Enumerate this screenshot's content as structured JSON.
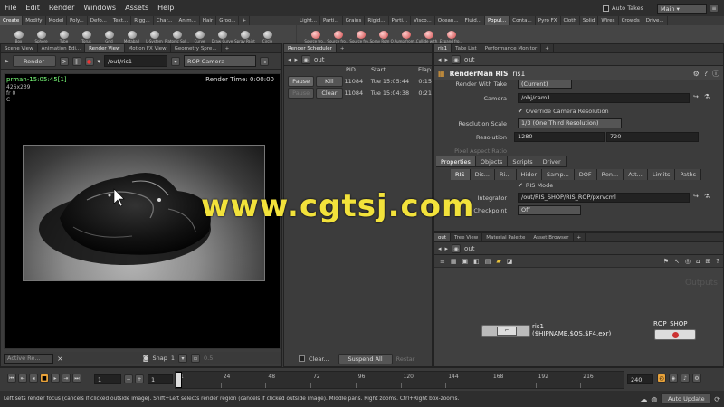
{
  "menu": [
    "File",
    "Edit",
    "Render",
    "Windows",
    "Assets",
    "Help"
  ],
  "auto_takes_label": "Auto Takes",
  "desktop": "Main",
  "shelf_tabs_left": [
    "Create",
    "Modify",
    "Model",
    "Poly...",
    "Defo...",
    "Text...",
    "Rigg...",
    "Char...",
    "Anim...",
    "Hair",
    "Groo..."
  ],
  "shelf_tabs_right": [
    "Light...",
    "Parti...",
    "Grains",
    "Rigid...",
    "Parti...",
    "Visco...",
    "Ocean...",
    "Fluid...",
    "Popul...",
    "Conta...",
    "Pyro FX",
    "Cloth",
    "Solid",
    "Wires",
    "Crowds",
    "Drive..."
  ],
  "tools_left": [
    "Box",
    "Sphere",
    "Tube",
    "Torus",
    "Grid",
    "Metaball",
    "L-System",
    "Platonic Sol...",
    "Curve",
    "Draw Curve",
    "Spray Paint",
    "Circle"
  ],
  "tools_right": [
    "Source fro...",
    "Source fro...",
    "Source fro...",
    "Spray Rom O...",
    "Pump from...",
    "Collide with...",
    "Expand fro..."
  ],
  "render_view": {
    "tabs": [
      "Scene View",
      "Animation Edi...",
      "Render View",
      "Motion FX View",
      "Geometry Spre..."
    ],
    "render_label": "Render",
    "path": "/out/ris1",
    "camera": "ROP Camera",
    "image_name": "prman-15:05:45[1]",
    "info": [
      "426x239",
      "fr 0",
      "C"
    ],
    "render_time": "Render Time: 0:00:00",
    "active_label": "Active Re...",
    "snap_label": "Snap",
    "snap_value": "1",
    "scale_value": "0.5"
  },
  "scheduler": {
    "tabs": [
      "Render Scheduler"
    ],
    "path": "out",
    "columns": [
      "PID",
      "Start",
      "Elap"
    ],
    "rows": [
      {
        "pid": "11084",
        "start": "Tue 15:05:44",
        "elap": "0:15"
      },
      {
        "pid": "11084",
        "start": "Tue 15:04:38",
        "elap": "0:21"
      }
    ],
    "pause_label": "Pause",
    "kill_label": "Kill",
    "clear_label": "Clear",
    "clear_check_label": "Clear...",
    "suspend_label": "Suspend All",
    "restart_label": "Restar"
  },
  "params": {
    "tabs": [
      "ris1",
      "Take List",
      "Performance Monitor"
    ],
    "path": "out",
    "node_type": "RenderMan RIS",
    "node_name": "ris1",
    "render_with_take_label": "Render With Take",
    "render_with_take_value": "(Current)",
    "camera_label": "Camera",
    "camera_value": "/obj/cam1",
    "override_label": "Override Camera Resolution",
    "res_scale_label": "Resolution Scale",
    "res_scale_value": "1/3 (One Third Resolution)",
    "resolution_label": "Resolution",
    "res_x": "1280",
    "res_y": "720",
    "pixel_aspect_label": "Pixel Aspect Ratio",
    "main_tabs": [
      "Properties",
      "Objects",
      "Scripts",
      "Driver"
    ],
    "sub_tabs": [
      "RIS",
      "Dis...",
      "Ri...",
      "Hider",
      "Samp...",
      "DOF",
      "Ren...",
      "Att...",
      "Limits",
      "Paths"
    ],
    "ris_mode_label": "RIS Mode",
    "integrator_label": "Integrator",
    "integrator_value": "/out/RIS_SHOP/RIS_ROP/pxrvcml",
    "cache_label": "Checkpoint",
    "cache_value": "Off"
  },
  "network": {
    "tabs": [
      "out",
      "Tree View",
      "Material Palette",
      "Asset Browser"
    ],
    "path": "out",
    "watermark_label": "Outputs",
    "node1_name": "ris1",
    "node1_expr": "($HIPNAME.$OS.$F4.exr)",
    "node2_name": "ROP_SHOP"
  },
  "timeline": {
    "current_frame": "1",
    "start_frame": "1",
    "end_frame": "240",
    "ticks": [
      "1",
      "24",
      "48",
      "72",
      "96",
      "120",
      "144",
      "168",
      "192",
      "216"
    ],
    "auto_update": "Auto Update"
  },
  "status_text": "Left sets render focus (cancels if clicked outside image). Shift+Left selects render region (cancels if clicked outside image). Middle pans. Right zooms. Ctrl+Right box-zooms.",
  "watermark": "www.cgtsj.com",
  "colors": {
    "accent": "#e8a23a",
    "render_green": "#7aff7a",
    "watermark": "#f2e23b"
  }
}
